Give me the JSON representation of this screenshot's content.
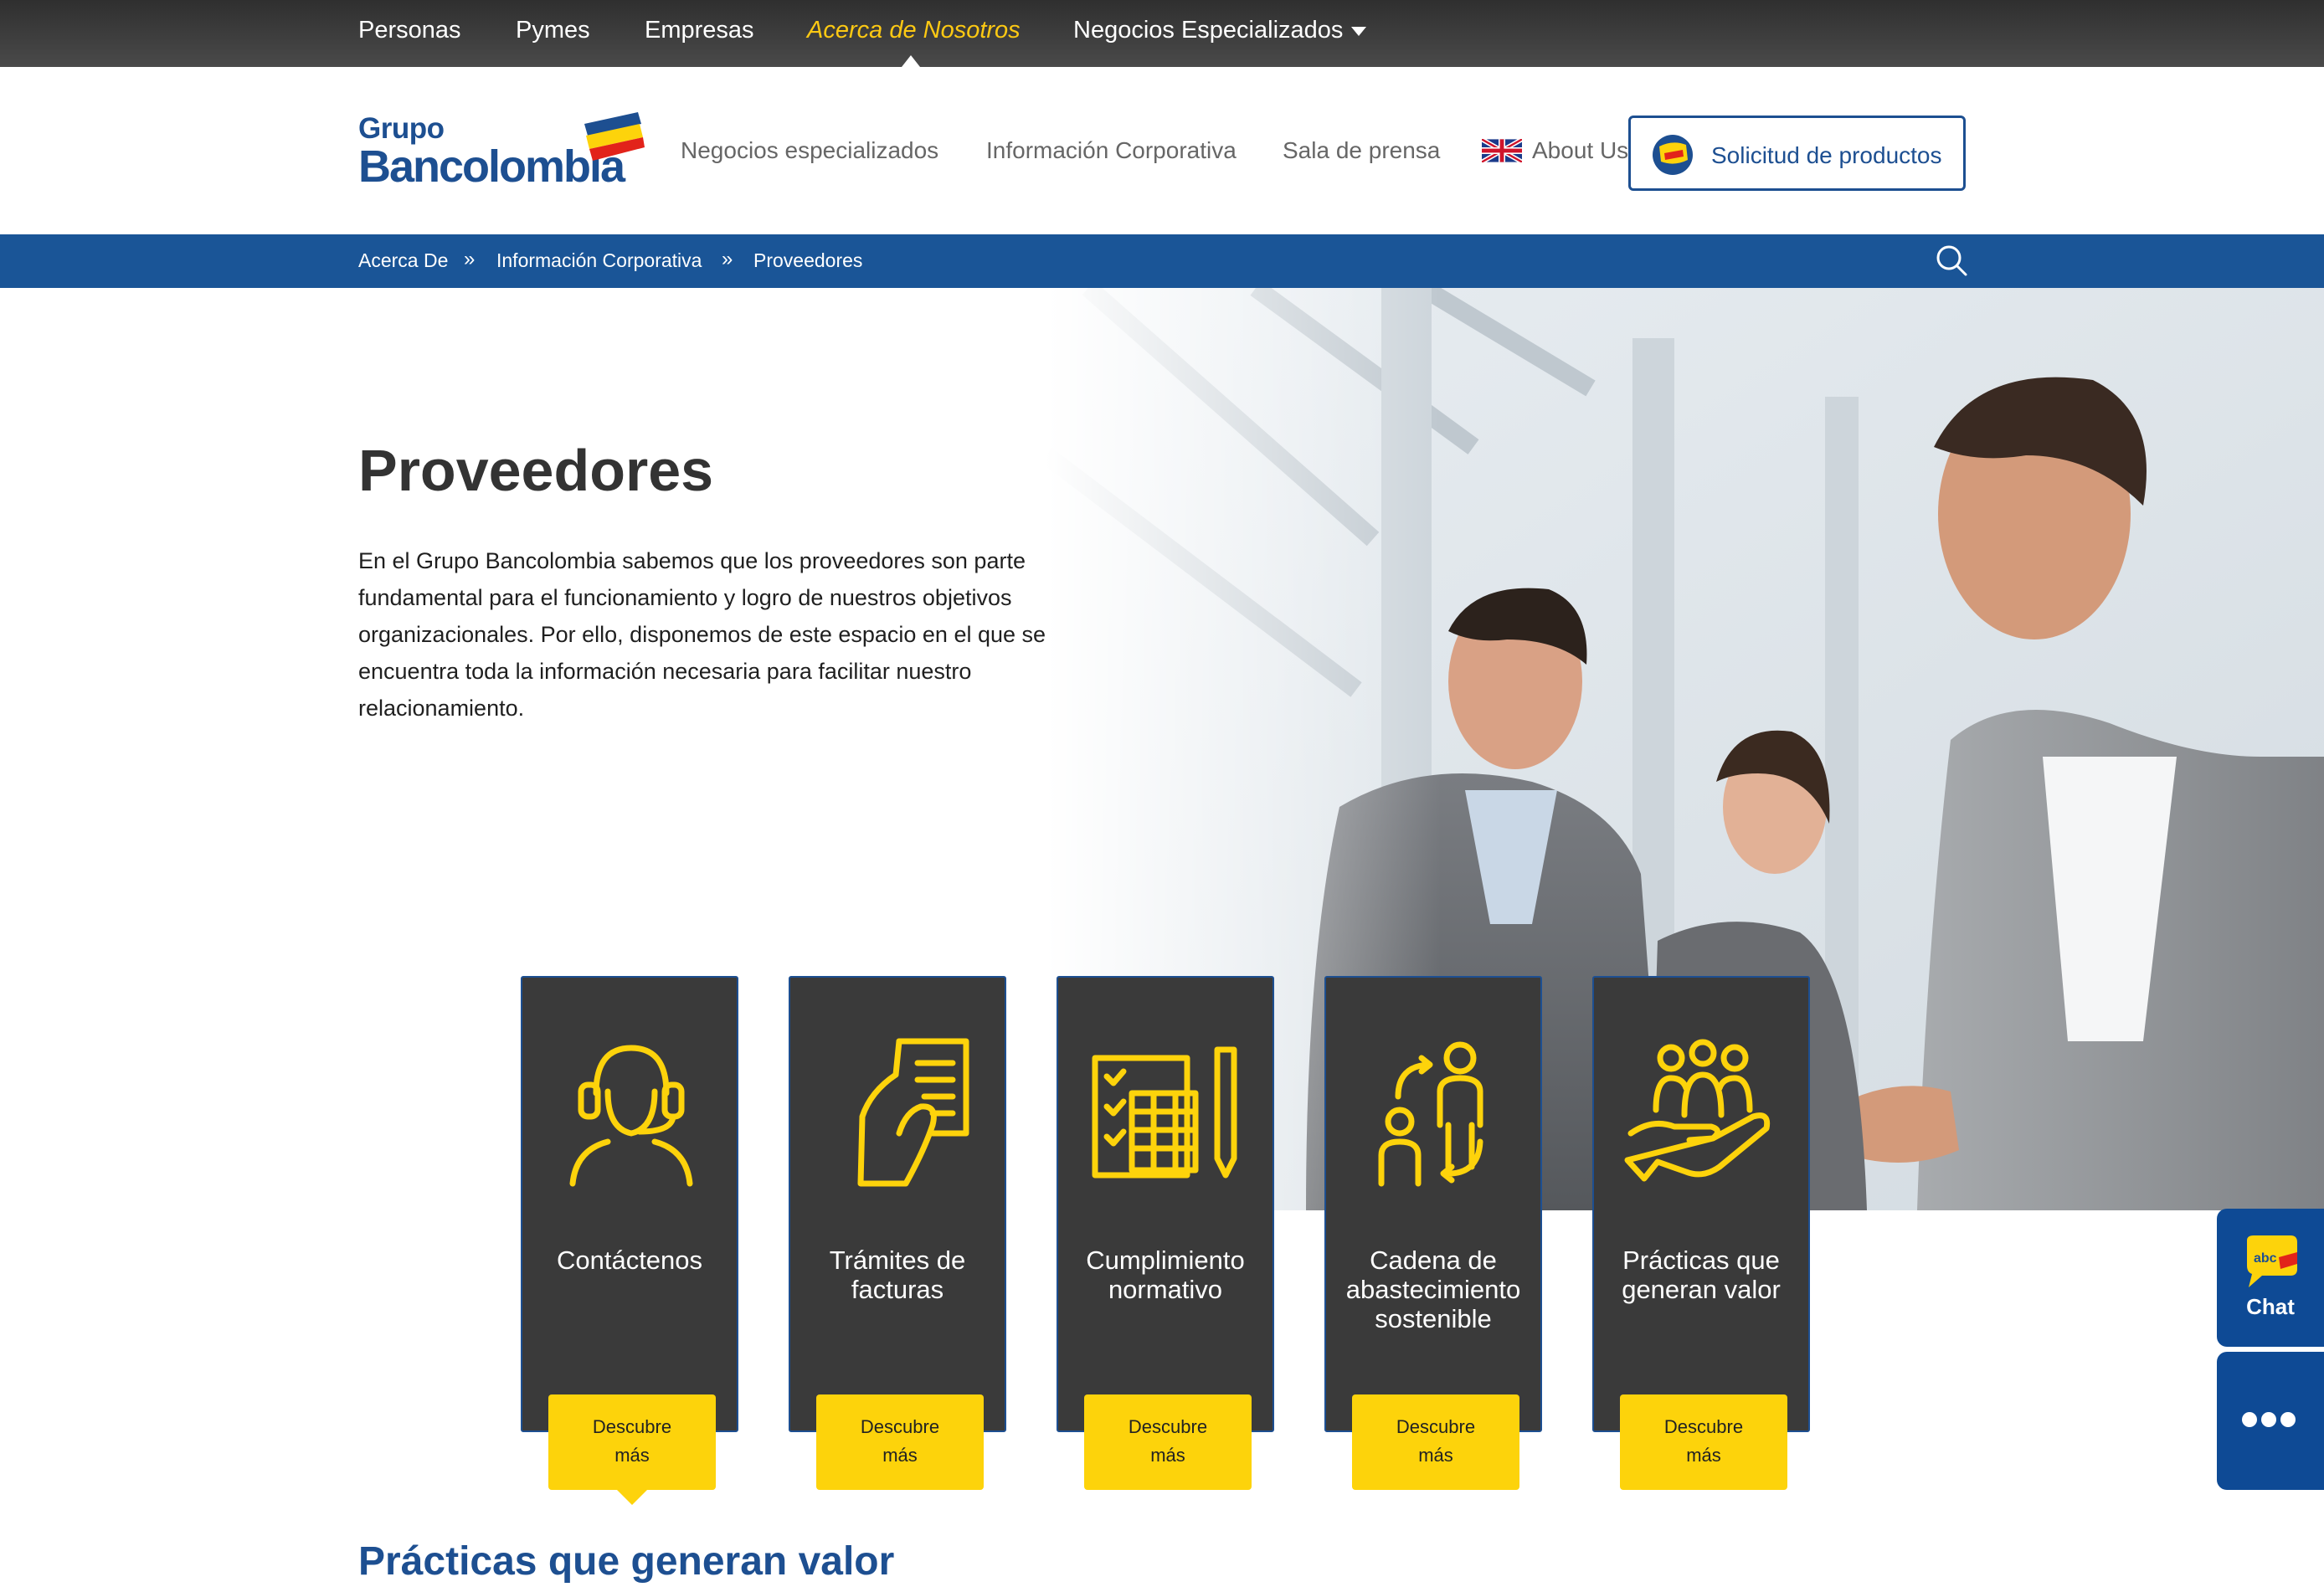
{
  "top_nav": {
    "items": [
      "Personas",
      "Pymes",
      "Empresas",
      "Acerca de Nosotros",
      "Negocios Especializados"
    ],
    "active": "Acerca de Nosotros"
  },
  "header": {
    "logo_line1": "Grupo",
    "logo_line2": "Bancolombia",
    "nav": [
      "Negocios especializados",
      "Información Corporativa",
      "Sala de prensa",
      "About Us"
    ],
    "solicitud_label": "Solicitud de productos"
  },
  "breadcrumb": [
    "Acerca De",
    "Información Corporativa",
    "Proveedores"
  ],
  "breadcrumb_separator": "»",
  "hero": {
    "title": "Proveedores",
    "intro": "En el Grupo Bancolombia sabemos que los proveedores son parte fundamental para el funcionamiento y logro de nuestros objetivos organizacionales. Por ello, disponemos de este espacio en el que se encuentra toda la información necesaria para facilitar nuestro relacionamiento."
  },
  "cards": [
    {
      "label": "Contáctenos",
      "icon": "headset-agent-icon",
      "button": "Descubre más"
    },
    {
      "label": "Trámites de facturas",
      "icon": "hand-receipt-icon",
      "button": "Descubre más"
    },
    {
      "label": "Cumplimiento normativo",
      "icon": "checklist-calculator-icon",
      "button": "Descubre más"
    },
    {
      "label": "Cadena de abastecimiento sostenible",
      "icon": "people-exchange-icon",
      "button": "Descubre más"
    },
    {
      "label": "Prácticas que generan valor",
      "icon": "hand-group-icon",
      "button": "Descubre más"
    }
  ],
  "section_title": "Prácticas que generan valor",
  "side_widgets": {
    "chat_badge": "abc",
    "chat_label": "Chat",
    "more_icon": "more-dots-icon"
  },
  "colors": {
    "primary_blue": "#1a5597",
    "accent_yellow": "#fdd30b",
    "card_dark": "#3a3a3a",
    "topbar_dark": "#3b3b3b"
  }
}
